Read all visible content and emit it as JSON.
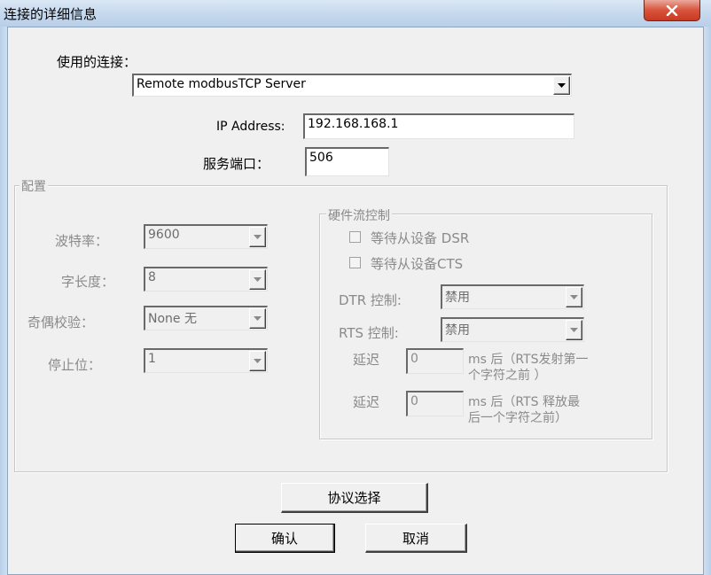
{
  "window": {
    "title": "连接的详细信息"
  },
  "connection": {
    "label": "使用的连接：",
    "selected": "Remote modbusTCP Server",
    "ip_label": "IP Address:",
    "ip_value": "192.168.168.1",
    "port_label": "服务端口：",
    "port_value": "506"
  },
  "config": {
    "group_title": "配置",
    "baud_label": "波特率：",
    "baud_value": "9600",
    "wordlen_label": "字长度：",
    "wordlen_value": "8",
    "parity_label": "奇偶校验：",
    "parity_value": "None 无",
    "stopbits_label": "停止位：",
    "stopbits_value": "1"
  },
  "flow": {
    "group_title": "硬件流控制",
    "wait_dsr": "等待从设备 DSR",
    "wait_cts": "等待从设备CTS",
    "dtr_label": "DTR 控制:",
    "dtr_value": "禁用",
    "rts_label": "RTS 控制:",
    "rts_value": "禁用",
    "delay1_label": "延迟",
    "delay1_value": "0",
    "delay1_note_1": "ms 后（RTS发射第一",
    "delay1_note_2": "个字符之前 ）",
    "delay2_label": "延迟",
    "delay2_value": "0",
    "delay2_note_1": "ms 后（RTS 释放最",
    "delay2_note_2": "后一个字符之前）"
  },
  "buttons": {
    "protocol": "协议选择",
    "ok": "确认",
    "cancel": "取消"
  },
  "icons": {
    "close": "close-icon",
    "dropdown": "chevron-down-icon"
  }
}
